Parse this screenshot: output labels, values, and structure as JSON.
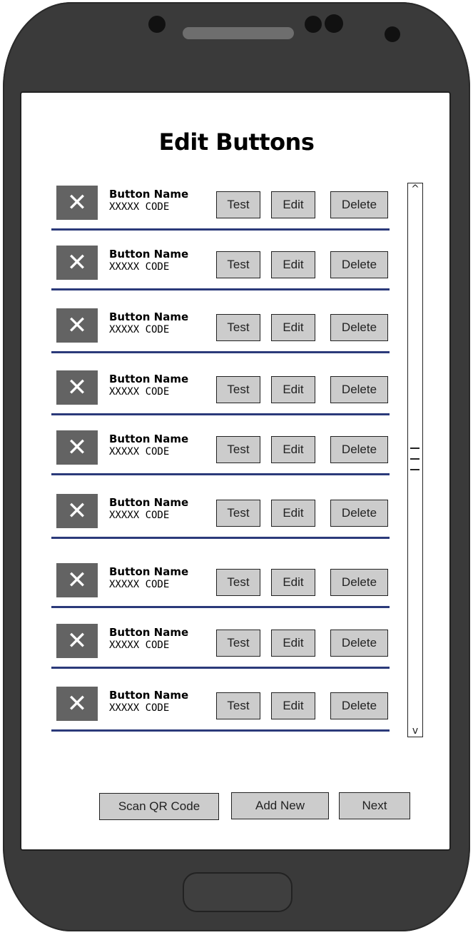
{
  "page": {
    "title": "Edit Buttons"
  },
  "list": {
    "items": [
      {
        "name": "Button Name",
        "code": "XXXXX CODE",
        "close_glyph": "✕",
        "test_label": "Test",
        "edit_label": "Edit",
        "delete_label": "Delete"
      },
      {
        "name": "Button Name",
        "code": "XXXXX CODE",
        "close_glyph": "✕",
        "test_label": "Test",
        "edit_label": "Edit",
        "delete_label": "Delete"
      },
      {
        "name": "Button Name",
        "code": "XXXXX CODE",
        "close_glyph": "✕",
        "test_label": "Test",
        "edit_label": "Edit",
        "delete_label": "Delete"
      },
      {
        "name": "Button Name",
        "code": "XXXXX CODE",
        "close_glyph": "✕",
        "test_label": "Test",
        "edit_label": "Edit",
        "delete_label": "Delete"
      },
      {
        "name": "Button Name",
        "code": "XXXXX CODE",
        "close_glyph": "✕",
        "test_label": "Test",
        "edit_label": "Edit",
        "delete_label": "Delete"
      },
      {
        "name": "Button Name",
        "code": "XXXXX CODE",
        "close_glyph": "✕",
        "test_label": "Test",
        "edit_label": "Edit",
        "delete_label": "Delete"
      },
      {
        "name": "Button Name",
        "code": "XXXXX CODE",
        "close_glyph": "✕",
        "test_label": "Test",
        "edit_label": "Edit",
        "delete_label": "Delete"
      },
      {
        "name": "Button Name",
        "code": "XXXXX CODE",
        "close_glyph": "✕",
        "test_label": "Test",
        "edit_label": "Edit",
        "delete_label": "Delete"
      },
      {
        "name": "Button Name",
        "code": "XXXXX CODE",
        "close_glyph": "✕",
        "test_label": "Test",
        "edit_label": "Edit",
        "delete_label": "Delete"
      }
    ]
  },
  "scrollbar": {
    "up_glyph": "^",
    "down_glyph": "v"
  },
  "footer": {
    "scan_label": "Scan QR Code",
    "add_label": "Add New",
    "next_label": "Next"
  },
  "colors": {
    "divider": "#2b3a7a",
    "button_fill": "#cccccc",
    "close_box": "#636363",
    "phone_body": "#3a3a3a"
  }
}
